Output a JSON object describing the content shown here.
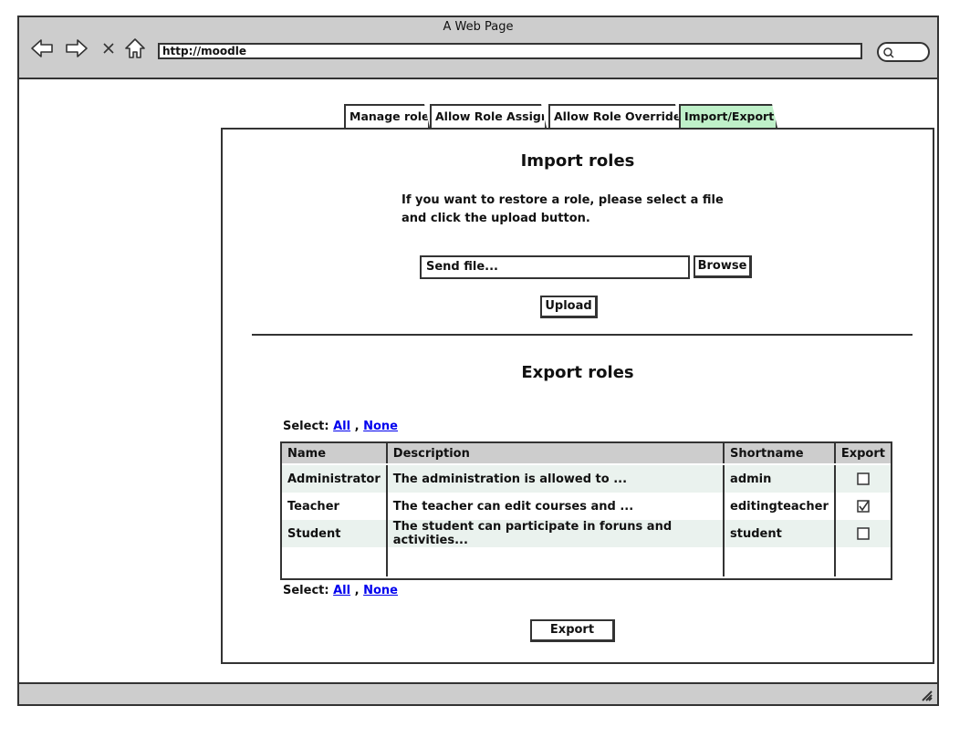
{
  "window": {
    "title": "A Web Page",
    "url": "http://moodle"
  },
  "tabs": [
    {
      "label": "Manage roles",
      "active": false
    },
    {
      "label": "Allow Role Assigns",
      "active": false
    },
    {
      "label": "Allow Role Overrides",
      "active": false
    },
    {
      "label": "Import/Export",
      "active": true
    }
  ],
  "import": {
    "title": "Import roles",
    "instructions": "If you want to restore a role, please select a file and click the upload button.",
    "file_placeholder": "Send file...",
    "browse_label": "Browse",
    "upload_label": "Upload"
  },
  "export": {
    "title": "Export roles",
    "select_label": "Select:",
    "select_all": "All",
    "select_separator": ",",
    "select_none": "None",
    "columns": [
      "Name",
      "Description",
      "Shortname",
      "Export"
    ],
    "rows": [
      {
        "name": "Administrator",
        "description": "The administration is allowed to ...",
        "shortname": "admin",
        "checked": false
      },
      {
        "name": "Teacher",
        "description": "The teacher can edit courses and ...",
        "shortname": "editingteacher",
        "checked": true
      },
      {
        "name": "Student",
        "description": "The student can participate in foruns and activities...",
        "shortname": "student",
        "checked": false
      }
    ],
    "export_label": "Export"
  },
  "colors": {
    "active_tab": "#bff0c9",
    "chrome": "#cdcdcd",
    "link": "#0000ee",
    "row_alt": "#eaf2ee"
  }
}
